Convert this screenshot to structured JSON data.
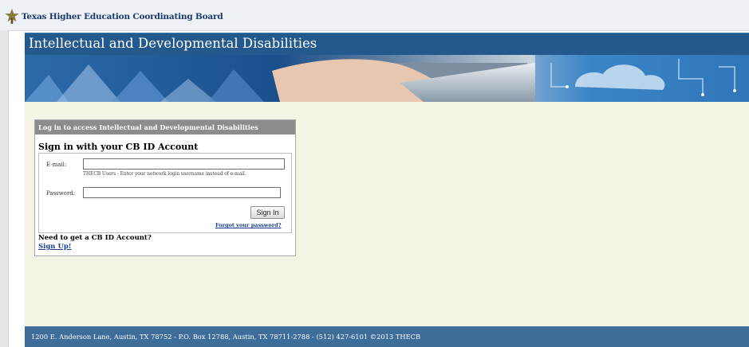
{
  "header": {
    "logo_icon": "star-icon",
    "organization": "Texas Higher Education Coordinating Board"
  },
  "site": {
    "title": "Intellectual and Developmental Disabilities"
  },
  "login": {
    "header": "Log in to access Intellectual and Developmental Disabilities",
    "title": "Sign in with your CB ID Account",
    "email_label": "E-mail:",
    "email_value": "",
    "email_hint": "THECB Users - Enter your network login username instead of e-mail.",
    "password_label": "Password:",
    "password_value": "",
    "signin_button": "Sign In",
    "forgot_link": "Forgot your password?",
    "need_account": "Need to get a CB ID Account?",
    "signup_link": "Sign Up!"
  },
  "footer": {
    "text": "1200 E. Anderson Lane, Austin, TX 78752 - P.O. Box 12788, Austin, TX 78711-2788 - (512) 427-6101 ©2013 THECB"
  },
  "colors": {
    "title_bar": "#23598c",
    "content_bg": "#f5f3e3",
    "footer_bg": "#3d6d98",
    "link": "#1a3d8a"
  }
}
